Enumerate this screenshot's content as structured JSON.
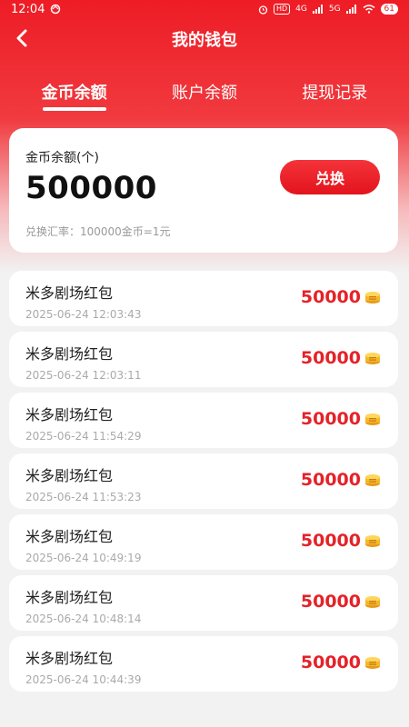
{
  "status_bar": {
    "time": "12:04",
    "hd": "HD",
    "net1": "4G",
    "net2": "5G",
    "battery": "61"
  },
  "header": {
    "title": "我的钱包"
  },
  "tabs": [
    {
      "label": "金币余额",
      "active": true
    },
    {
      "label": "账户余额",
      "active": false
    },
    {
      "label": "提现记录",
      "active": false
    }
  ],
  "balance": {
    "label": "金币余额(个)",
    "value": "500000",
    "exchange_button": "兑换",
    "exchange_rate": "兑换汇率：100000金币=1元"
  },
  "records": [
    {
      "title": "米多剧场红包",
      "time": "2025-06-24 12:03:43",
      "amount": "50000"
    },
    {
      "title": "米多剧场红包",
      "time": "2025-06-24 12:03:11",
      "amount": "50000"
    },
    {
      "title": "米多剧场红包",
      "time": "2025-06-24 11:54:29",
      "amount": "50000"
    },
    {
      "title": "米多剧场红包",
      "time": "2025-06-24 11:53:23",
      "amount": "50000"
    },
    {
      "title": "米多剧场红包",
      "time": "2025-06-24 10:49:19",
      "amount": "50000"
    },
    {
      "title": "米多剧场红包",
      "time": "2025-06-24 10:48:14",
      "amount": "50000"
    },
    {
      "title": "米多剧场红包",
      "time": "2025-06-24 10:44:39",
      "amount": "50000"
    }
  ],
  "colors": {
    "brand_red": "#e52228",
    "amount_red": "#e52228"
  },
  "icons": {
    "back": "chevron-left-icon",
    "coin": "coin-stack-icon"
  }
}
